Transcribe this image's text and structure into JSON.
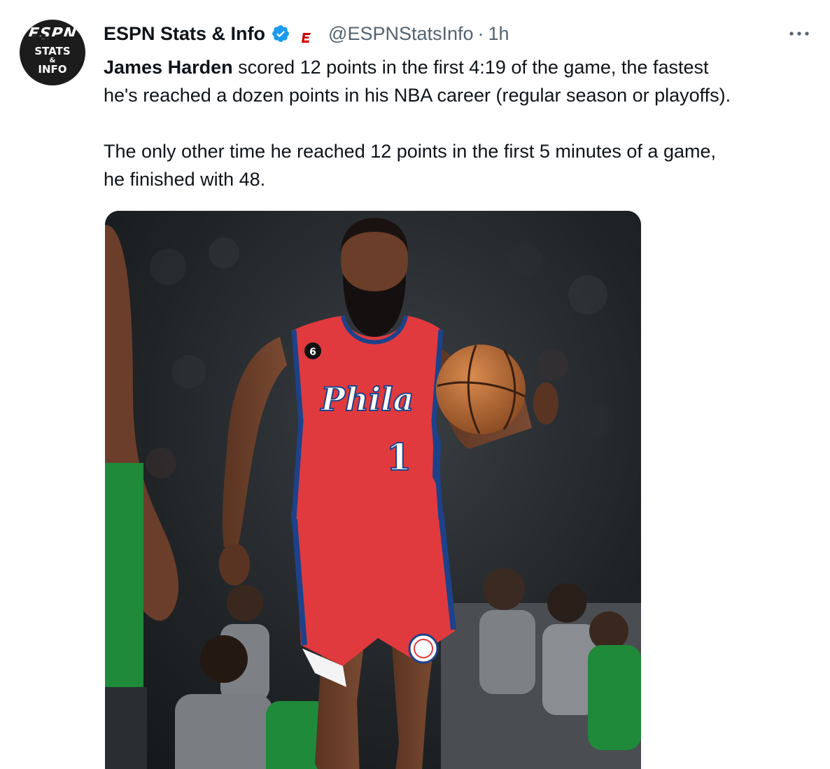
{
  "tweet": {
    "author": {
      "display_name": "ESPN Stats & Info",
      "handle": "@ESPNStatsInfo",
      "separator": "·",
      "time": "1h",
      "avatar": {
        "line1": "ESPN",
        "line2": "STATS",
        "line3": "&",
        "line4": "INFO"
      }
    },
    "text": {
      "mention": "James Harden",
      "line1_rest": " scored 12 points in the first 4:19 of the game, the fastest",
      "line2": "he's reached a dozen points in his NBA career (regular season or playoffs).",
      "para2_line1": "The only other time he reached 12 points in the first 5 minutes of a game,",
      "para2_line2": "he finished with 48."
    },
    "media": {
      "jersey_text": "Phila",
      "jersey_number": "1",
      "patch_number": "6"
    }
  },
  "colors": {
    "verified_blue": "#1d9bf0",
    "espn_red": "#d00000",
    "secondary_text": "#536471",
    "jersey_red": "#e03a3e",
    "jersey_blue": "#1d428a"
  },
  "icons": {
    "verified": "verified-badge-icon",
    "affiliate": "espn-affiliate-icon",
    "more": "more-options-icon"
  }
}
